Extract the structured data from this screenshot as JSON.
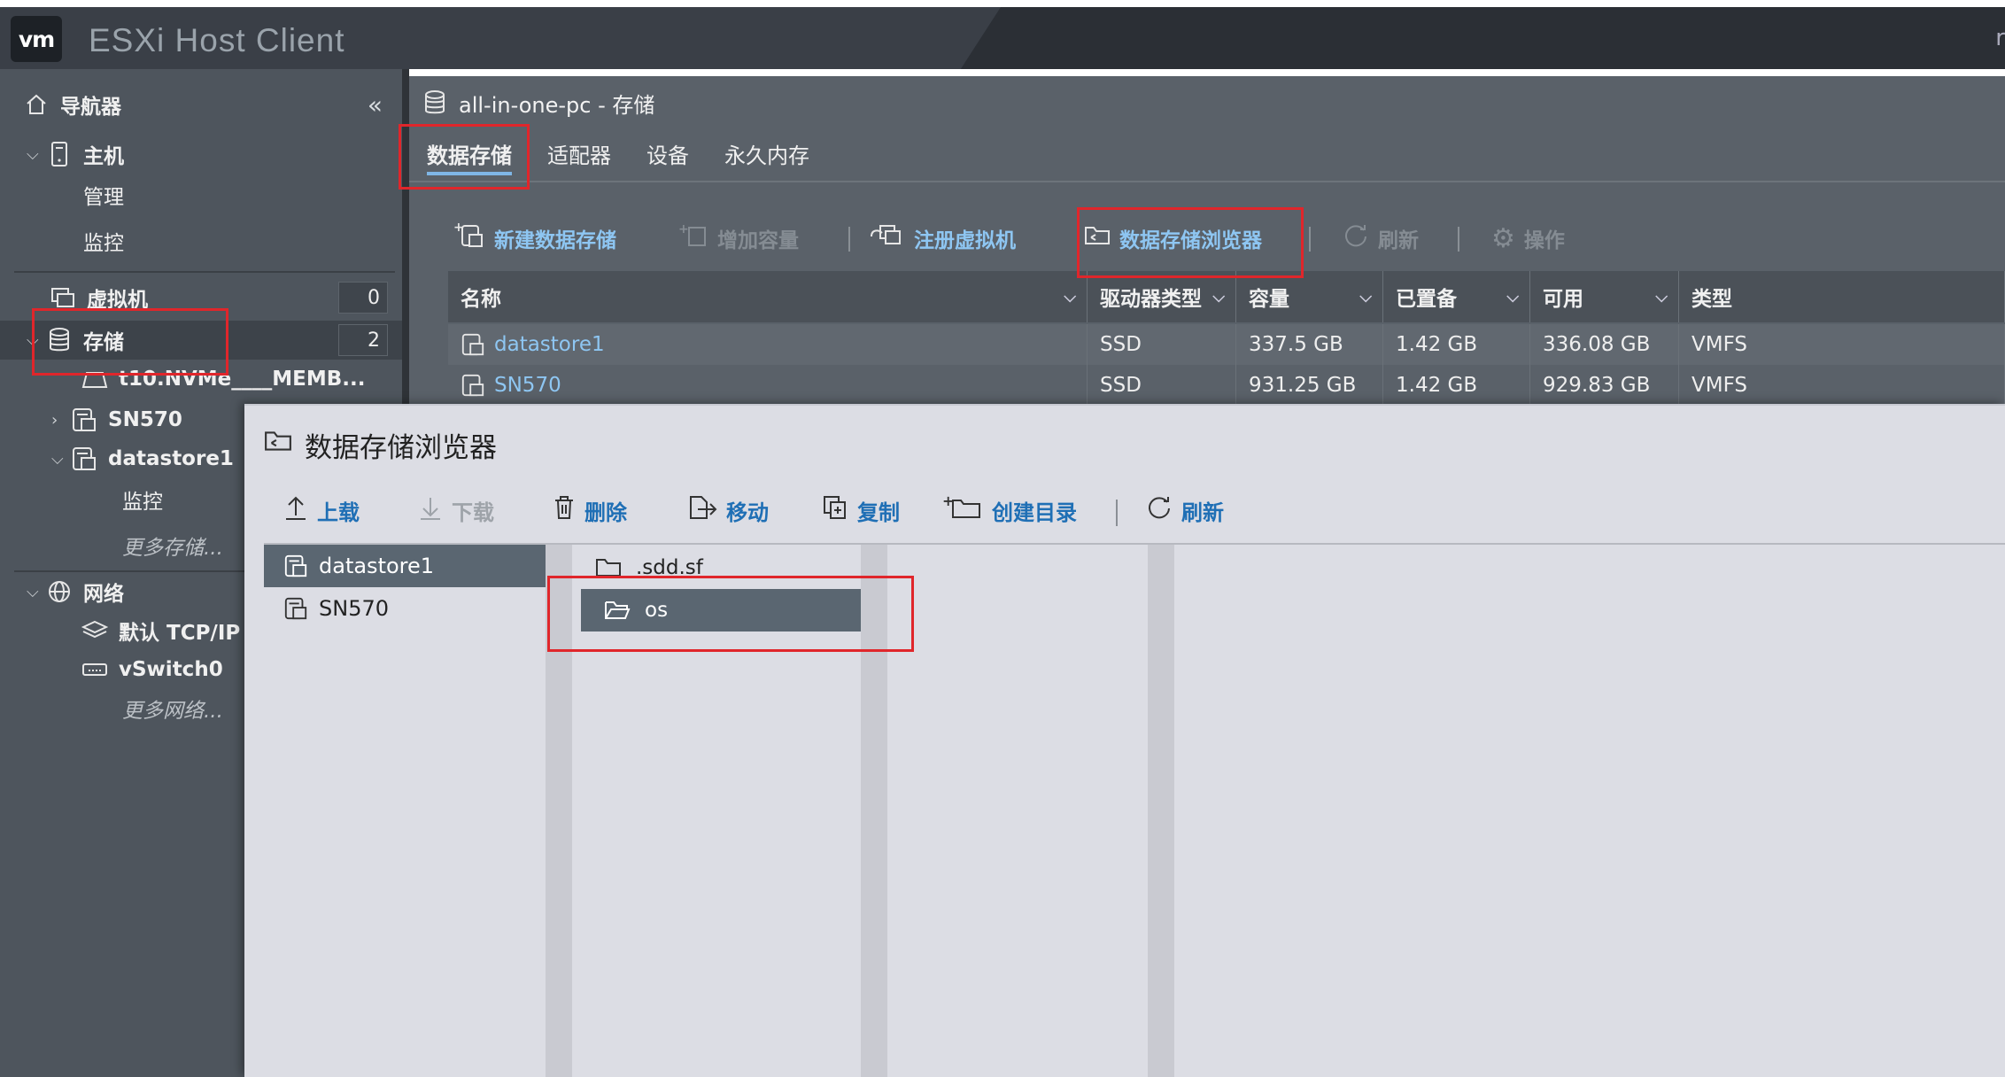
{
  "app": {
    "logo": "vm",
    "title": "ESXi Host Client",
    "user_cut": "r"
  },
  "navigator": {
    "title": "导航器",
    "collapse_icon": "double-chevron-left",
    "host": {
      "label": "主机",
      "children": [
        "管理",
        "监控"
      ]
    },
    "vms": {
      "label": "虚拟机",
      "count": "0"
    },
    "storage": {
      "label": "存储",
      "count": "2",
      "items": [
        {
          "label": "t10.NVMe____MEMB..."
        },
        {
          "label": "SN570"
        },
        {
          "label": "datastore1",
          "children": [
            "监控"
          ]
        }
      ],
      "more": "更多存储..."
    },
    "network": {
      "label": "网络",
      "items": [
        "默认 TCP/IP",
        "vSwitch0"
      ],
      "more": "更多网络..."
    }
  },
  "main": {
    "header": "all-in-one-pc - 存储",
    "tabs": [
      "数据存储",
      "适配器",
      "设备",
      "永久内存"
    ],
    "active_tab": "数据存储",
    "toolbar": {
      "new_datastore": "新建数据存储",
      "increase_capacity": "增加容量",
      "register_vm": "注册虚拟机",
      "datastore_browser": "数据存储浏览器",
      "refresh": "刷新",
      "actions": "操作"
    },
    "grid": {
      "columns": [
        "名称",
        "驱动器类型",
        "容量",
        "已置备",
        "可用",
        "类型"
      ],
      "rows": [
        {
          "name": "datastore1",
          "drive": "SSD",
          "capacity": "337.5 GB",
          "provisioned": "1.42 GB",
          "free": "336.08 GB",
          "type": "VMFS"
        },
        {
          "name": "SN570",
          "drive": "SSD",
          "capacity": "931.25 GB",
          "provisioned": "1.42 GB",
          "free": "929.83 GB",
          "type": "VMFS"
        }
      ]
    }
  },
  "dialog": {
    "title": "数据存储浏览器",
    "toolbar": {
      "upload": "上载",
      "download": "下载",
      "delete": "删除",
      "move": "移动",
      "copy": "复制",
      "mkdir": "创建目录",
      "refresh": "刷新"
    },
    "datastores": [
      "datastore1",
      "SN570"
    ],
    "selected_datastore": "datastore1",
    "folders": [
      ".sdd.sf",
      "os"
    ],
    "selected_folder": "os"
  },
  "colors": {
    "highlight": "#e0262b",
    "link": "#8ec6f2",
    "dialog_link": "#1f6fb5"
  }
}
